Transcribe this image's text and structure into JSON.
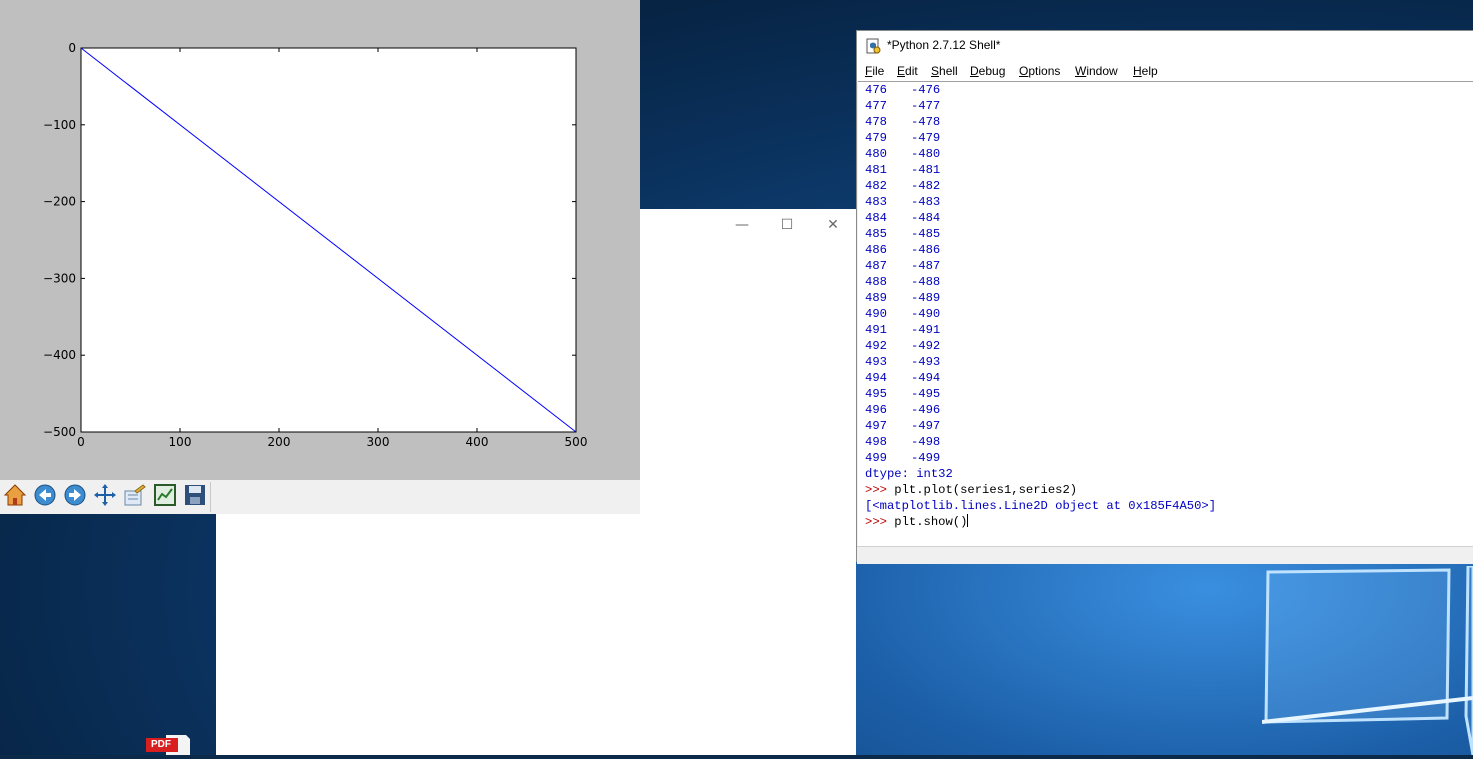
{
  "figure": {
    "chart_data": {
      "type": "line",
      "title": "",
      "xlabel": "",
      "ylabel": "",
      "xlim": [
        0,
        500
      ],
      "ylim": [
        -500,
        0
      ],
      "xticks": [
        "0",
        "100",
        "200",
        "300",
        "400",
        "500"
      ],
      "yticks": [
        "0",
        "−100",
        "−200",
        "−300",
        "−400",
        "−500"
      ],
      "series": [
        {
          "x": [
            0,
            500
          ],
          "y": [
            0,
            -500
          ],
          "color": "#0000ff"
        }
      ],
      "grid": false
    },
    "toolbar": [
      "home-icon",
      "back-icon",
      "forward-icon",
      "pan-icon",
      "configure-subplots-icon",
      "zoom-icon",
      "save-icon"
    ]
  },
  "blank_window": {
    "minimize": "—",
    "maximize": "☐",
    "close": "✕"
  },
  "idle": {
    "title": "*Python 2.7.12 Shell*",
    "menu": [
      "File",
      "Edit",
      "Shell",
      "Debug",
      "Options",
      "Window",
      "Help"
    ],
    "output_rows": [
      [
        "476",
        "-476"
      ],
      [
        "477",
        "-477"
      ],
      [
        "478",
        "-478"
      ],
      [
        "479",
        "-479"
      ],
      [
        "480",
        "-480"
      ],
      [
        "481",
        "-481"
      ],
      [
        "482",
        "-482"
      ],
      [
        "483",
        "-483"
      ],
      [
        "484",
        "-484"
      ],
      [
        "485",
        "-485"
      ],
      [
        "486",
        "-486"
      ],
      [
        "487",
        "-487"
      ],
      [
        "488",
        "-488"
      ],
      [
        "489",
        "-489"
      ],
      [
        "490",
        "-490"
      ],
      [
        "491",
        "-491"
      ],
      [
        "492",
        "-492"
      ],
      [
        "493",
        "-493"
      ],
      [
        "494",
        "-494"
      ],
      [
        "495",
        "-495"
      ],
      [
        "496",
        "-496"
      ],
      [
        "497",
        "-497"
      ],
      [
        "498",
        "-498"
      ],
      [
        "499",
        "-499"
      ]
    ],
    "dtype_line": "dtype: int32",
    "prompt": ">>>",
    "cmd1": "plt.plot(series1,series2)",
    "result1": "[<matplotlib.lines.Line2D object at 0x185F4A50>]",
    "cmd2": "plt.show()"
  },
  "desktop": {
    "pdf_label": "PDF"
  },
  "colors": {
    "output_blue": "#0000c0",
    "prompt_red": "#c00000",
    "line_blue": "#0000ff"
  }
}
